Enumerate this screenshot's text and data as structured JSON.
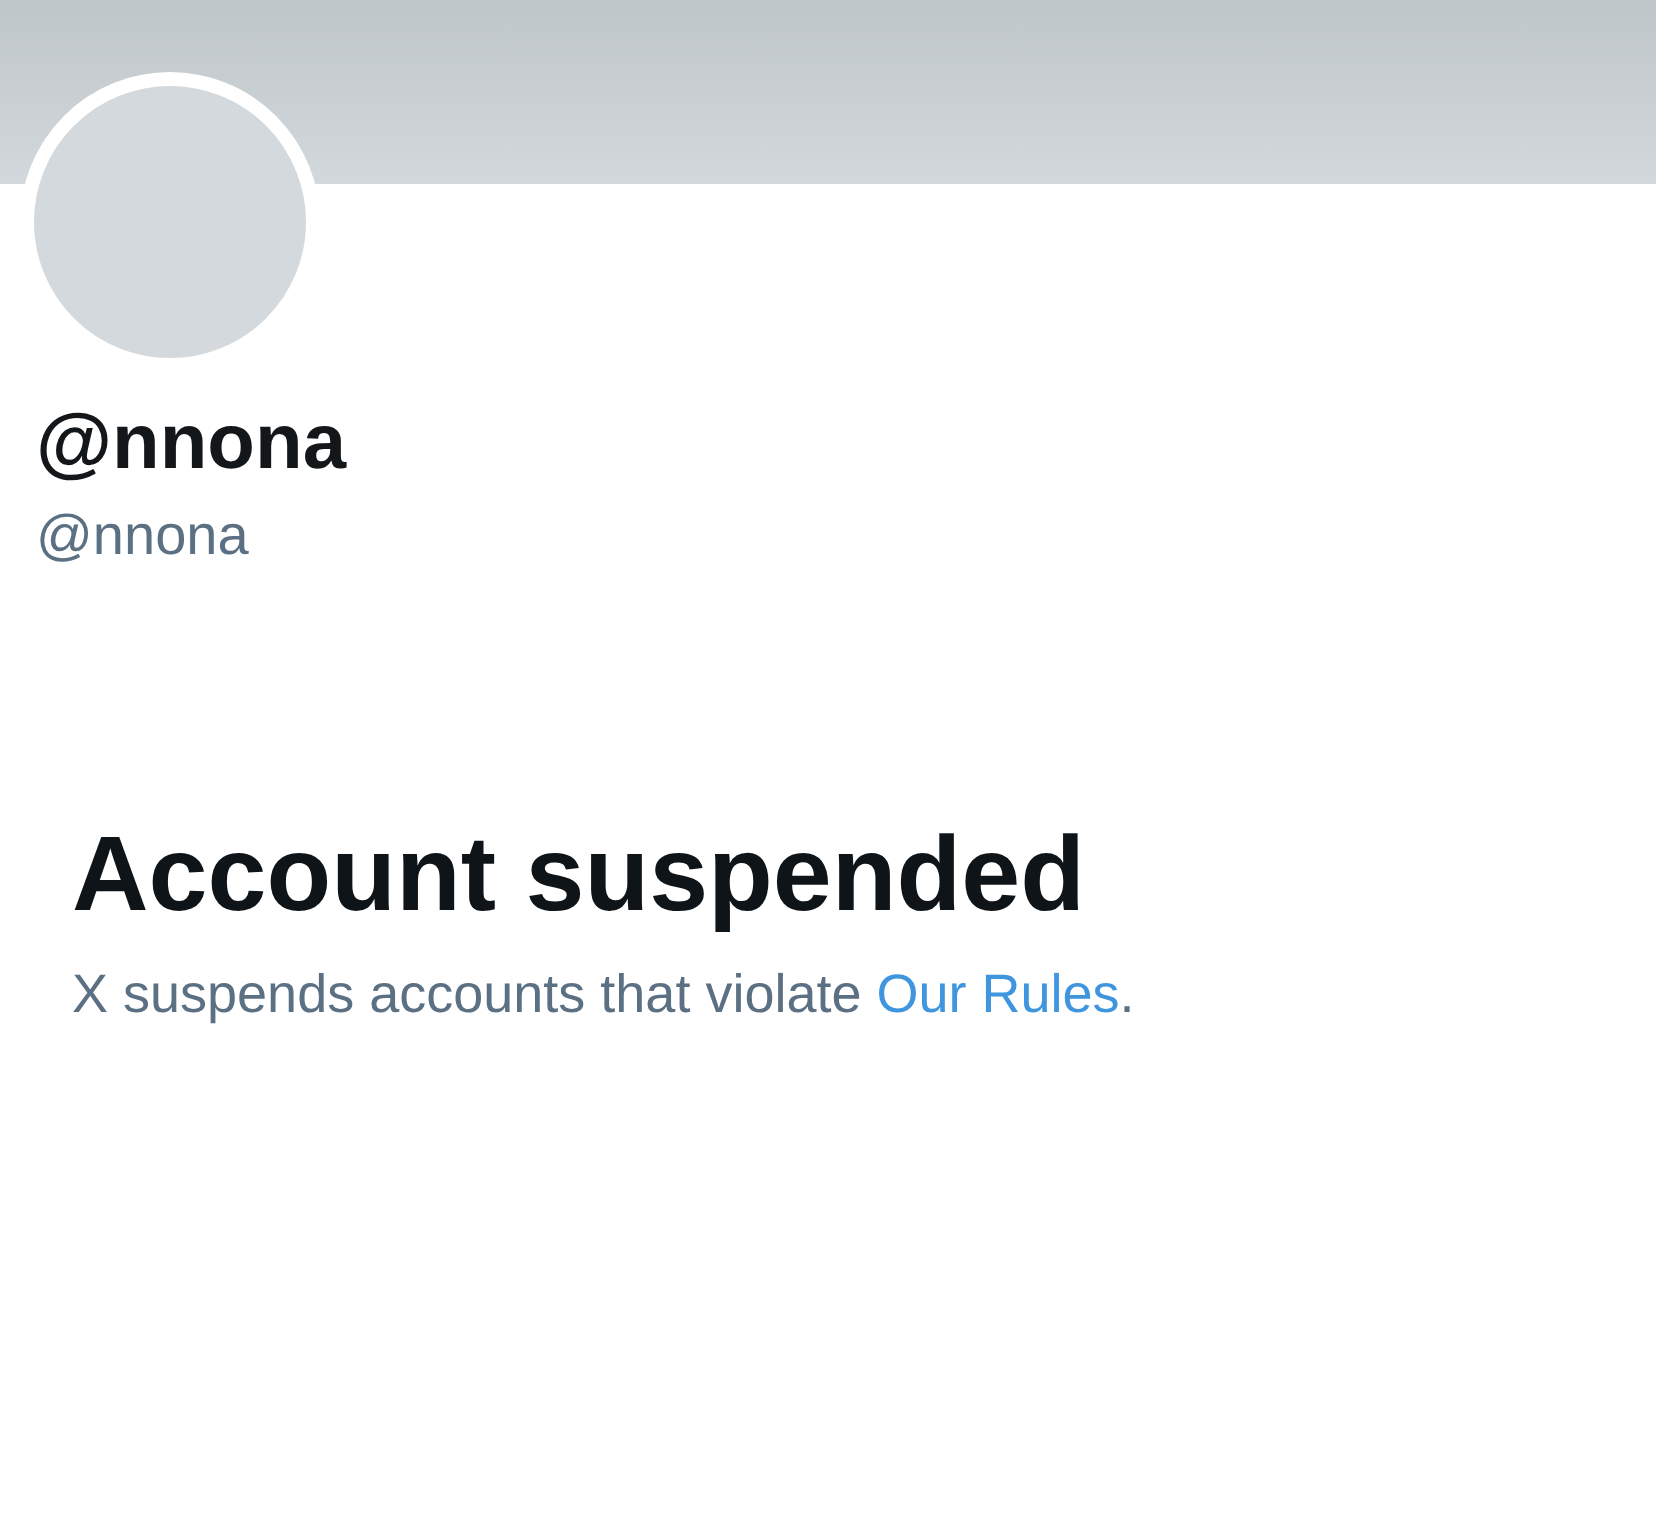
{
  "profile": {
    "display_name": "@nnona",
    "handle": "@nnona"
  },
  "notice": {
    "title": "Account suspended",
    "text": "X suspends accounts that violate ",
    "link": "Our Rules",
    "after": "."
  }
}
